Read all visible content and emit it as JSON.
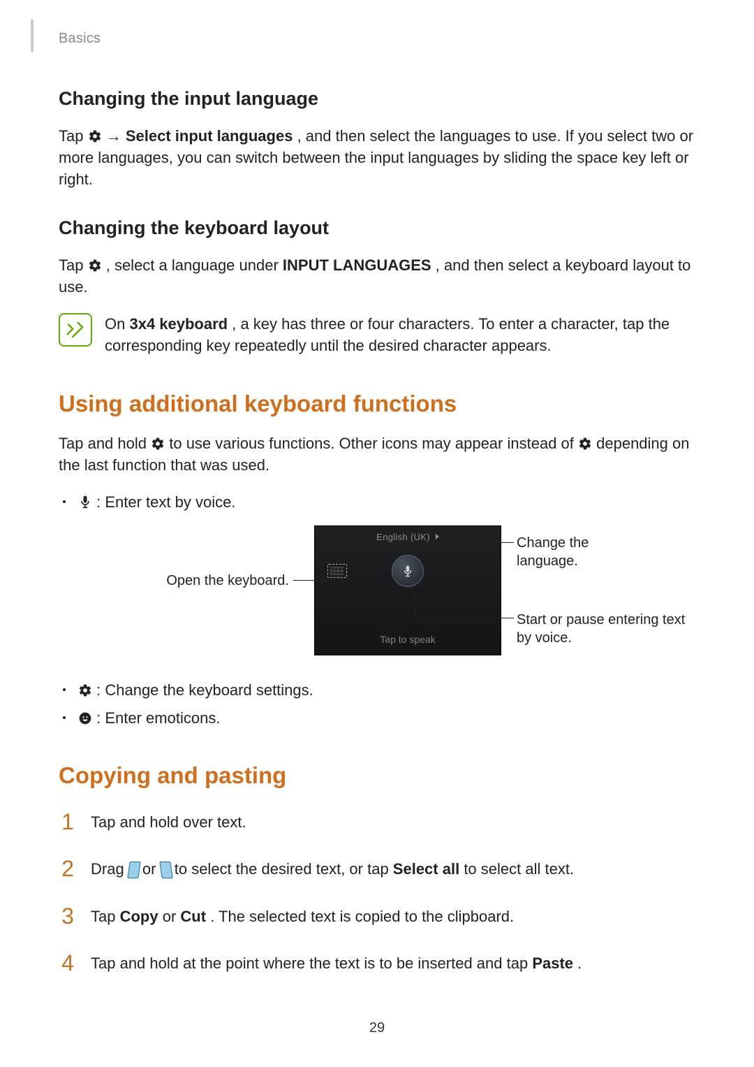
{
  "header": {
    "section": "Basics"
  },
  "section1": {
    "heading": "Changing the input language",
    "para_pre": "Tap ",
    "para_mid": " → ",
    "para_bold1": "Select input languages",
    "para_post": ", and then select the languages to use. If you select two or more languages, you can switch between the input languages by sliding the space key left or right."
  },
  "section2": {
    "heading": "Changing the keyboard layout",
    "para_pre": "Tap ",
    "para_mid": ", select a language under ",
    "para_bold1": "INPUT LANGUAGES",
    "para_post": ", and then select a keyboard layout to use."
  },
  "note": {
    "pre": "On ",
    "bold": "3x4 keyboard",
    "post": ", a key has three or four characters. To enter a character, tap the corresponding key repeatedly until the desired character appears."
  },
  "kbfunc": {
    "heading": "Using additional keyboard functions",
    "para_pre": "Tap and hold ",
    "para_mid": " to use various functions. Other icons may appear instead of ",
    "para_post": " depending on the last function that was used.",
    "bullets": {
      "voice": ": Enter text by voice.",
      "settings": ": Change the keyboard settings.",
      "emoticons": ": Enter emoticons."
    }
  },
  "diagram": {
    "lang": "English (UK)",
    "tap": "Tap to speak",
    "callouts": {
      "open_keyboard": "Open the keyboard.",
      "change_language": "Change the language.",
      "voice": "Start or pause entering text by voice."
    }
  },
  "copy": {
    "heading": "Copying and pasting",
    "step1": "Tap and hold over text.",
    "step2_pre": "Drag ",
    "step2_mid": " or ",
    "step2_mid2": " to select the desired text, or tap ",
    "step2_bold": "Select all",
    "step2_post": " to select all text.",
    "step3_pre": "Tap ",
    "step3_bold1": "Copy",
    "step3_mid": " or ",
    "step3_bold2": "Cut",
    "step3_post": ". The selected text is copied to the clipboard.",
    "step4_pre": "Tap and hold at the point where the text is to be inserted and tap ",
    "step4_bold": "Paste",
    "step4_post": "."
  },
  "page_number": "29"
}
